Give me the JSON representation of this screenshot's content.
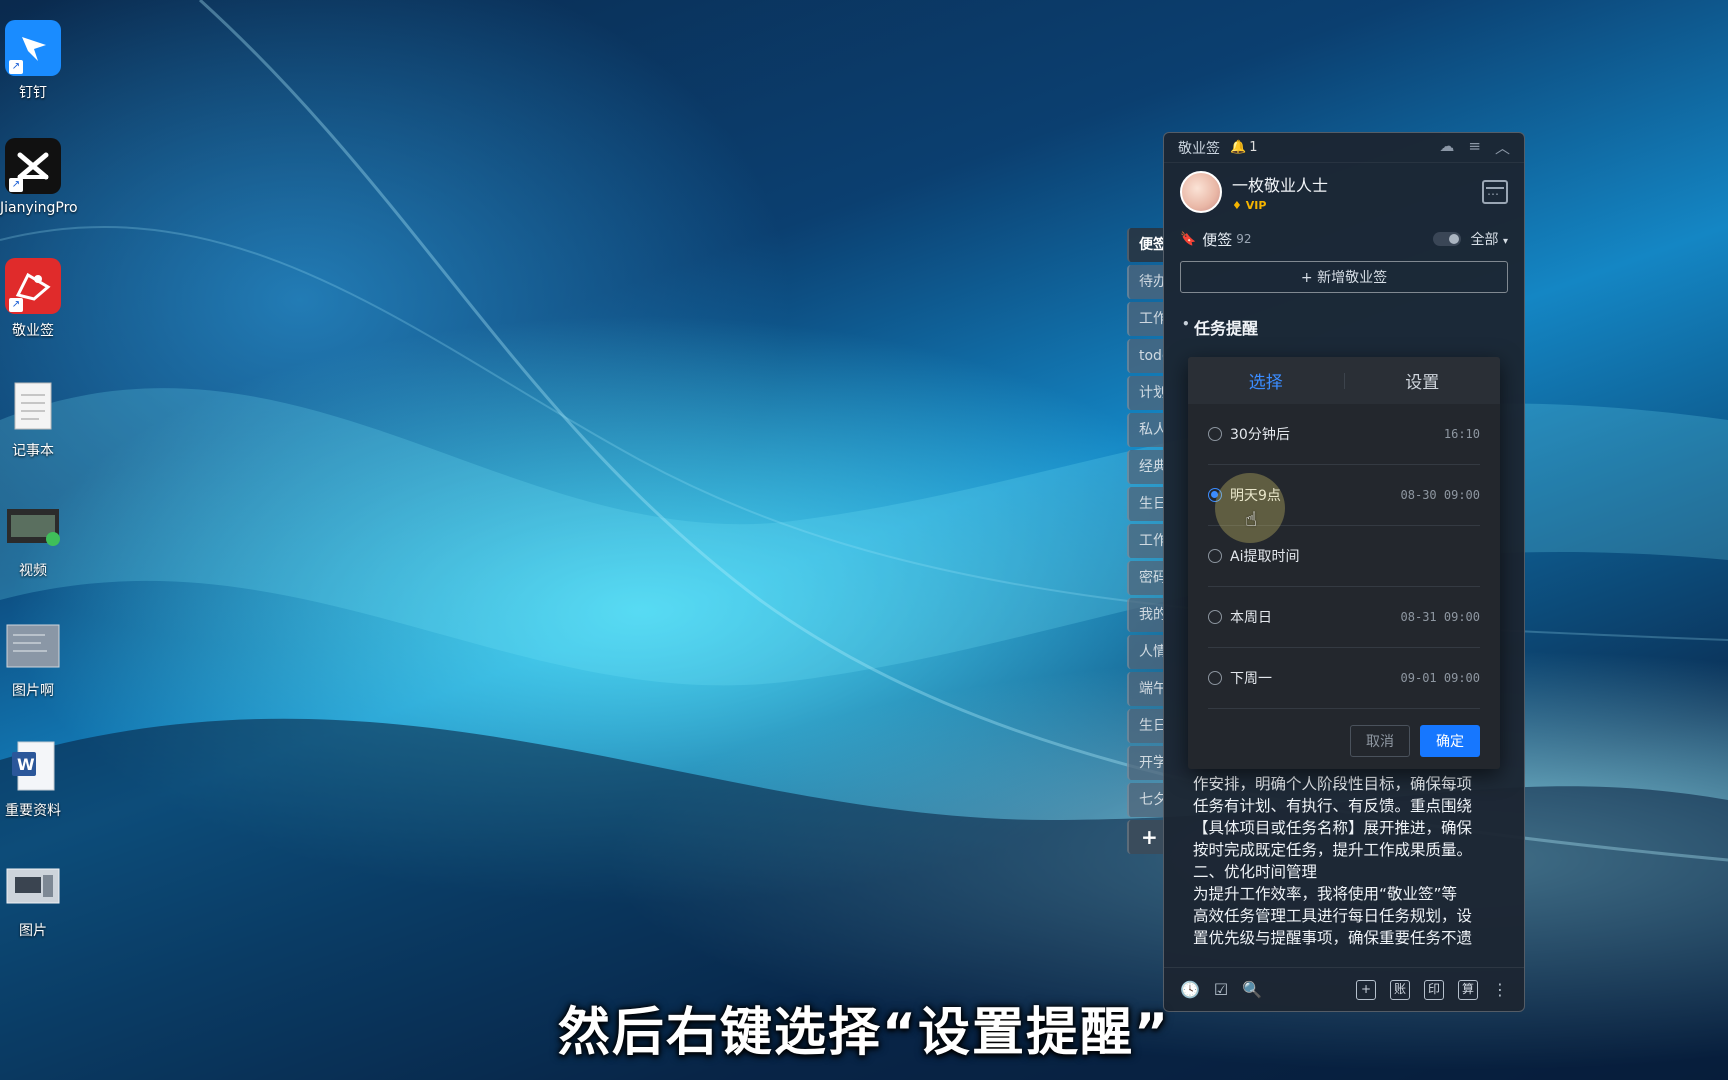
{
  "desktop": {
    "icons": [
      {
        "label": "钉钉",
        "icon": "dingtalk-icon",
        "color": "#1a8cff"
      },
      {
        "label": "JianyingPro",
        "icon": "jianying-icon",
        "color": "#111111"
      },
      {
        "label": "敬业签",
        "icon": "jingyeqian-icon",
        "color": "#e02b2b"
      },
      {
        "label": "记事本",
        "icon": "notepad-icon",
        "color": "#f3f3f3"
      },
      {
        "label": "视频",
        "icon": "video-icon",
        "color": "#2b2b2b"
      },
      {
        "label": "图片啊",
        "icon": "image-file-icon",
        "color": "#8a97a6"
      },
      {
        "label": "重要资料",
        "icon": "word-doc-icon",
        "color": "#2b579a"
      },
      {
        "label": "图片",
        "icon": "picture-icon",
        "color": "#b9c2cc"
      }
    ]
  },
  "side_tabs": [
    "便签",
    "待办",
    "工作",
    "todo",
    "计划",
    "私人",
    "经典",
    "生日",
    "工作",
    "密码",
    "我的",
    "人情",
    "端午",
    "生日",
    "开学",
    "七夕"
  ],
  "side_add": "+",
  "app": {
    "title": "敬业签",
    "notification_count": "1",
    "user_name": "一枚敬业人士",
    "vip_label": "VIP",
    "notes_label": "便签",
    "notes_count": "92",
    "filter_label": "全部",
    "new_button": "+ 新增敬业签",
    "section_title": "任务提醒",
    "body_lines": [
      "作安排，明确个人阶段性目标，确保每项",
      "任务有计划、有执行、有反馈。重点围绕",
      "【具体项目或任务名称】展开推进，确保",
      "按时完成既定任务，提升工作成果质量。",
      "二、优化时间管理",
      "为提升工作效率，我将使用“敬业签”等",
      "高效任务管理工具进行每日任务规划，设",
      "置优先级与提醒事项，确保重要任务不遗"
    ],
    "bottom_right_buttons": [
      "+",
      "账",
      "印",
      "算"
    ]
  },
  "reminder_popup": {
    "tabs": [
      "选择",
      "设置"
    ],
    "active_tab": "选择",
    "options": [
      {
        "label": "30分钟后",
        "time": "16:10",
        "selected": false
      },
      {
        "label": "明天9点",
        "time": "08-30 09:00",
        "selected": true
      },
      {
        "label": "Ai提取时间",
        "time": "",
        "selected": false
      },
      {
        "label": "本周日",
        "time": "08-31 09:00",
        "selected": false
      },
      {
        "label": "下周一",
        "time": "09-01 09:00",
        "selected": false
      }
    ],
    "cancel_label": "取消",
    "ok_label": "确定",
    "accent_color": "#1677ff"
  },
  "subtitle": "然后右键选择“设置提醒”"
}
